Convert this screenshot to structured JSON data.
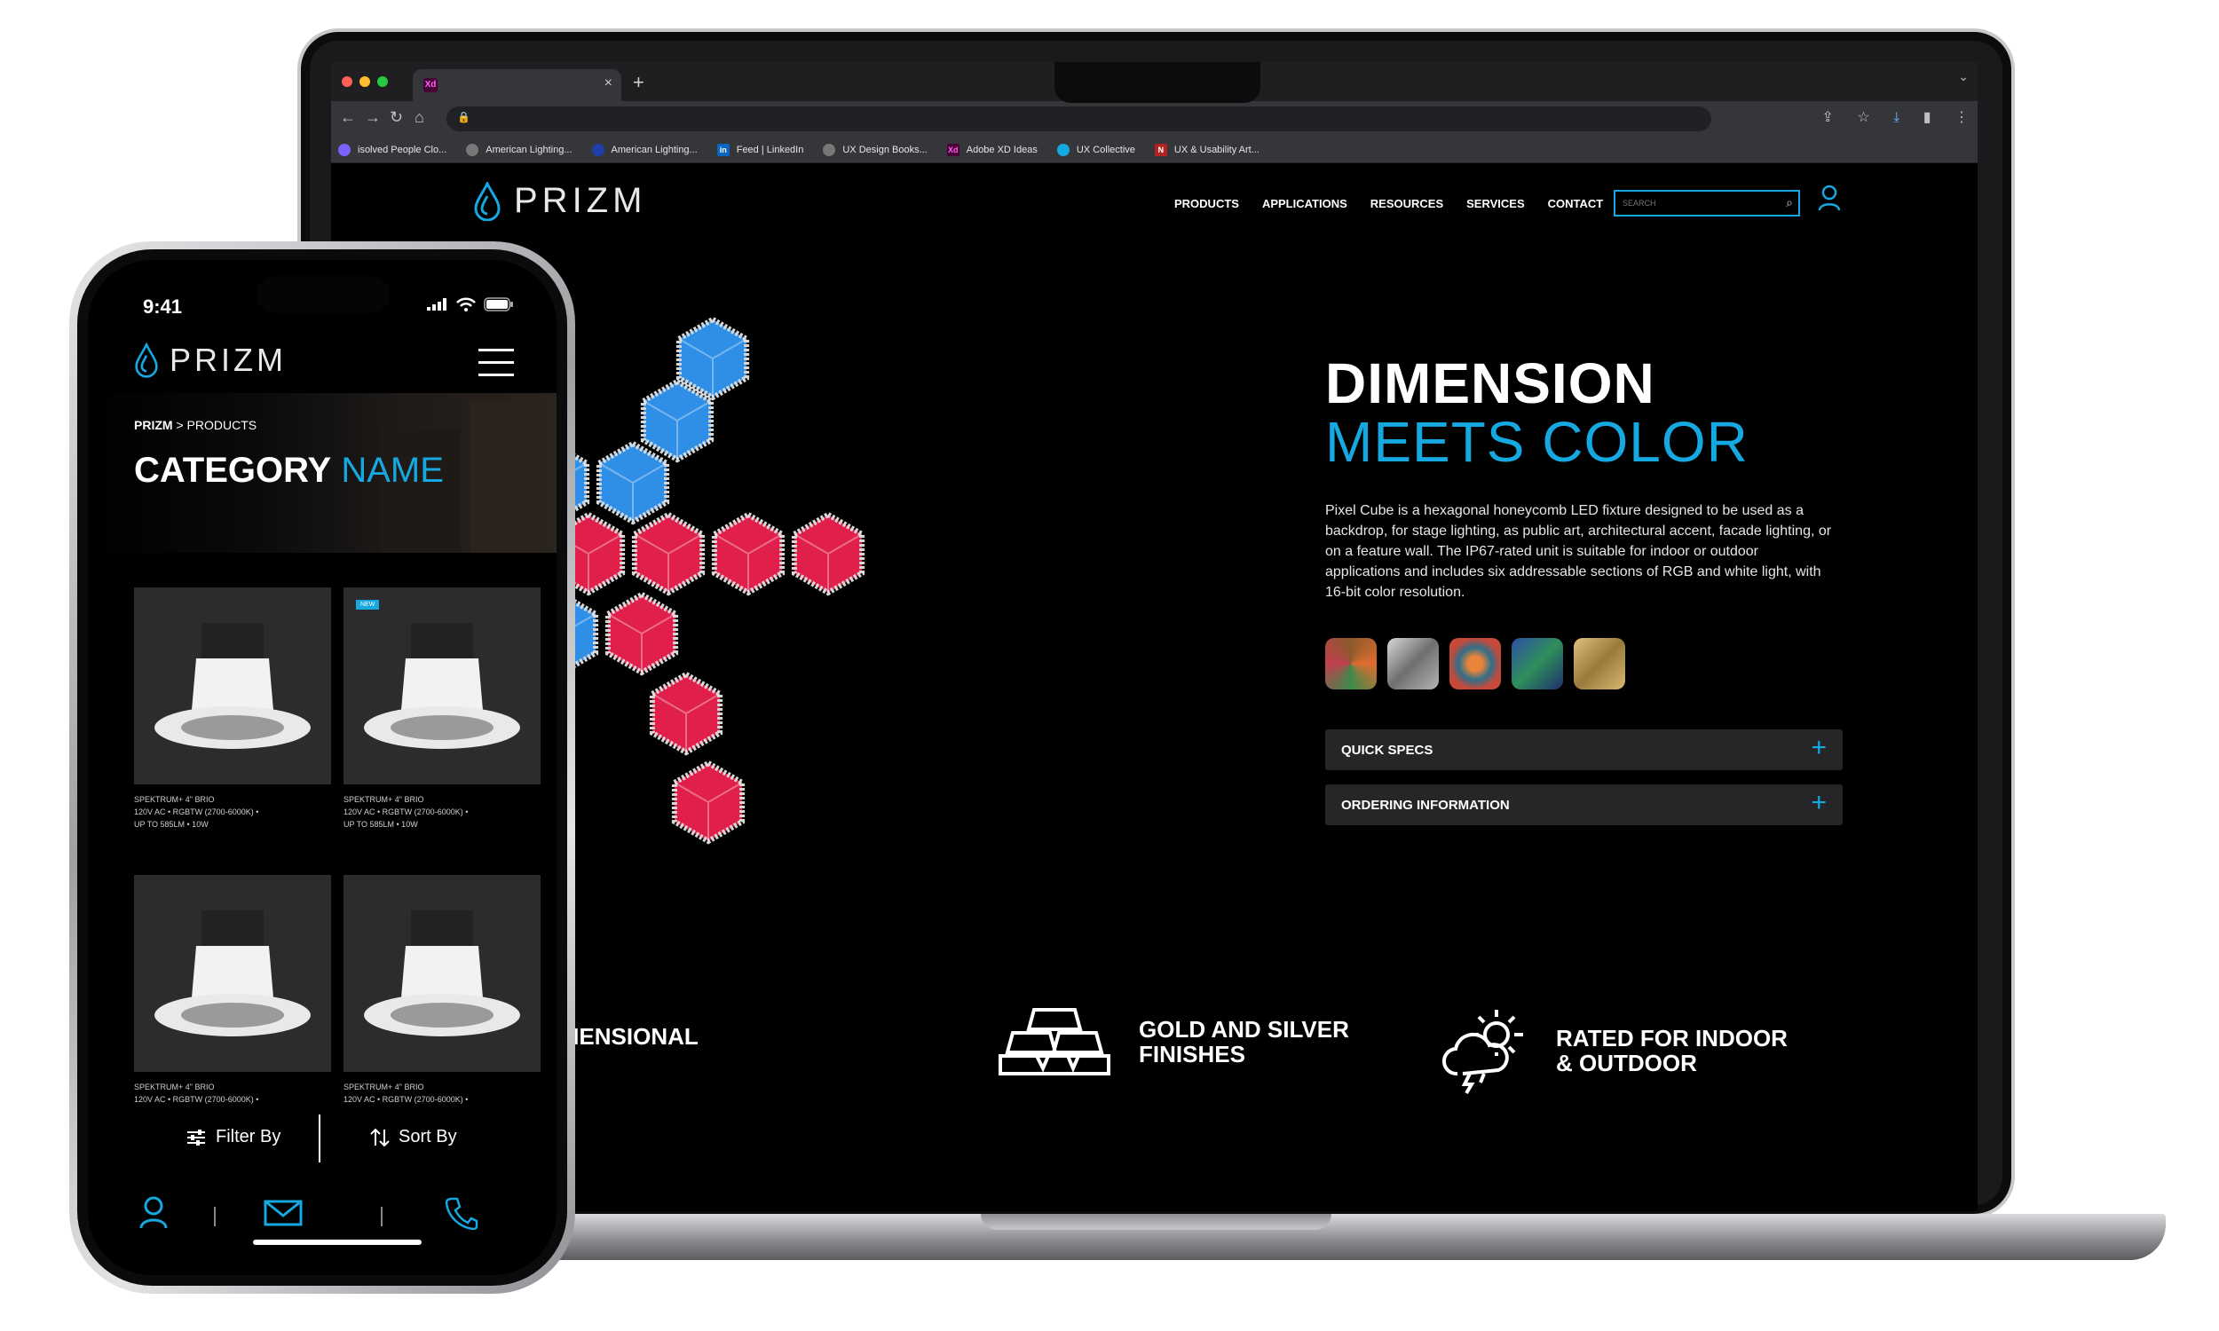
{
  "browser": {
    "tab_title": "",
    "bookmarks": [
      {
        "label": "isolved People Clo...",
        "icon": "isolved-icon",
        "color": "#7b61ff"
      },
      {
        "label": "American Lighting...",
        "icon": "globe-icon",
        "color": "#777777"
      },
      {
        "label": "American Lighting...",
        "icon": "al-icon",
        "color": "#1e3fa8"
      },
      {
        "label": "Feed | LinkedIn",
        "icon": "linkedin-icon",
        "color": "#0a66c2"
      },
      {
        "label": "UX Design Books...",
        "icon": "globe-icon",
        "color": "#777777"
      },
      {
        "label": "Adobe XD Ideas",
        "icon": "xd-icon",
        "color": "#470137"
      },
      {
        "label": "UX Collective",
        "icon": "uxc-icon",
        "color": "#16a8e0"
      },
      {
        "label": "UX & Usability Art...",
        "icon": "nn-icon",
        "color": "#b22222"
      }
    ]
  },
  "site": {
    "brand": "PRIZM",
    "nav": [
      "PRODUCTS",
      "APPLICATIONS",
      "RESOURCES",
      "SERVICES",
      "CONTACT"
    ],
    "search_placeholder": "SEARCH",
    "hero": {
      "title_line1": "DIMENSION",
      "title_line2": "MEETS COLOR",
      "description": "Pixel Cube is a hexagonal honeycomb LED fixture designed to be used as a backdrop, for stage lighting, as public art, architectural accent, facade lighting, or on a feature wall. The IP67-rated unit is suitable for indoor or outdoor applications and includes six addressable sections of RGB and white light, with 16-bit color resolution."
    },
    "swatches": [
      "multicolor",
      "silver",
      "pattern",
      "blue-green",
      "gold"
    ],
    "accordions": [
      "QUICK SPECS",
      "ORDERING INFORMATION"
    ],
    "features": [
      {
        "text": "THREE-DIMENSIONAL\nDESIGN",
        "icon": "cube-icon"
      },
      {
        "text": "GOLD AND SILVER\nFINISHES",
        "icon": "gold-bars-icon"
      },
      {
        "text": "RATED FOR INDOOR\n& OUTDOOR",
        "icon": "weather-icon"
      }
    ]
  },
  "phone": {
    "time": "9:41",
    "brand": "PRIZM",
    "breadcrumb_root": "PRIZM",
    "breadcrumb_sep": " > ",
    "breadcrumb_current": "PRODUCTS",
    "title_bold": "CATEGORY",
    "title_light": "NAME",
    "badge": "NEW",
    "products": [
      {
        "line1": "SPEKTRUM+ 4\" BRIO",
        "line2": "120V AC • RGBTW (2700-6000K) •",
        "line3": "UP TO 585LM • 10W"
      },
      {
        "line1": "SPEKTRUM+ 4\" BRIO",
        "line2": "120V AC • RGBTW (2700-6000K) •",
        "line3": "UP TO 585LM • 10W"
      },
      {
        "line1": "SPEKTRUM+ 4\" BRIO",
        "line2": "120V AC • RGBTW (2700-6000K) •",
        "line3": ""
      },
      {
        "line1": "SPEKTRUM+ 4\" BRIO",
        "line2": "120V AC • RGBTW (2700-6000K) •",
        "line3": ""
      }
    ],
    "filter_label": "Filter By",
    "sort_label": "Sort By"
  },
  "colors": {
    "accent": "#16a8e0",
    "cube_blue": "#2f8fe6",
    "cube_red": "#e0204a"
  }
}
